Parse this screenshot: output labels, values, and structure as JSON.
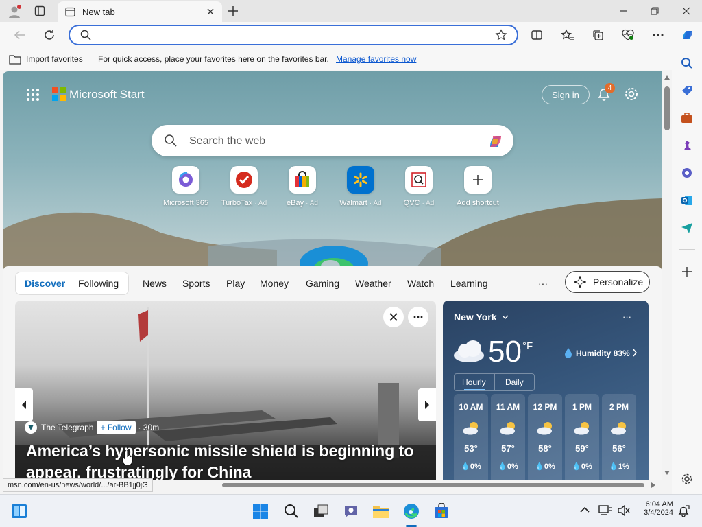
{
  "browser": {
    "tab_title": "New tab",
    "address_value": "",
    "favorites_bar": {
      "import_label": "Import favorites",
      "message": "For quick access, place your favorites here on the favorites bar.",
      "manage_link": "Manage favorites now"
    }
  },
  "page": {
    "brand": "Microsoft Start",
    "sign_in": "Sign in",
    "notification_count": "4",
    "search_placeholder": "Search the web",
    "shortcuts": [
      {
        "label": "Microsoft 365",
        "ad": ""
      },
      {
        "label": "TurboTax",
        "ad": "· Ad"
      },
      {
        "label": "eBay",
        "ad": "· Ad"
      },
      {
        "label": "Walmart",
        "ad": "· Ad"
      },
      {
        "label": "QVC",
        "ad": "· Ad"
      },
      {
        "label": "Add shortcut",
        "ad": ""
      }
    ],
    "nav": {
      "discover": "Discover",
      "following": "Following",
      "items": [
        "News",
        "Sports",
        "Play",
        "Money",
        "Gaming",
        "Weather",
        "Watch",
        "Learning"
      ],
      "more": "···",
      "personalize": "Personalize"
    },
    "story": {
      "source": "The Telegraph",
      "follow": "+ Follow",
      "age": "· 30m",
      "headline": "America’s hypersonic missile shield is beginning to appear, frustratingly for China"
    },
    "weather": {
      "city": "New York",
      "temp": "50",
      "unit": "°F",
      "humidity": "Humidity 83%",
      "tab_hourly": "Hourly",
      "tab_daily": "Daily",
      "hours": [
        {
          "time": "10 AM",
          "temp": "53°",
          "precip": "0%"
        },
        {
          "time": "11 AM",
          "temp": "57°",
          "precip": "0%"
        },
        {
          "time": "12 PM",
          "temp": "58°",
          "precip": "0%"
        },
        {
          "time": "1 PM",
          "temp": "59°",
          "precip": "0%"
        },
        {
          "time": "2 PM",
          "temp": "56°",
          "precip": "1%"
        }
      ]
    },
    "status_url": "msn.com/en-us/news/world/.../ar-BB1jj0jG"
  },
  "taskbar": {
    "time": "6:04 AM",
    "date": "3/4/2024"
  },
  "colors": {
    "accent": "#0f6cbd",
    "link": "#0b57d0",
    "omnibox_border": "#3a6fd8"
  }
}
